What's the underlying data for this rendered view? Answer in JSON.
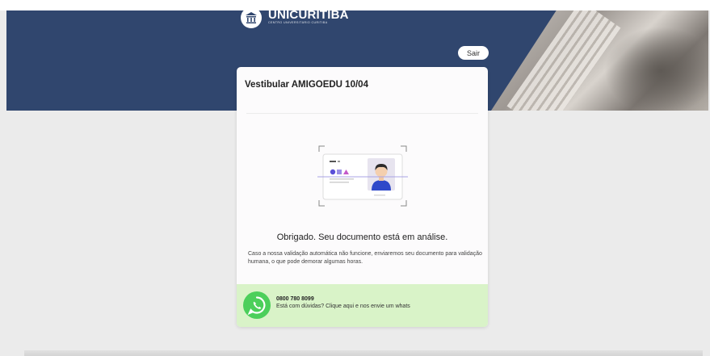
{
  "header": {
    "logo_title": "UNICURITIBA",
    "logo_subtitle": "CENTRO UNIVERSITÁRIO CURITIBA",
    "logout_label": "Sair"
  },
  "card": {
    "title": "Vestibular AMIGOEDU 10/04",
    "success_title": "Obrigado. Seu documento está em análise.",
    "success_description": "Caso a nossa validação automática não funcione, enviaremos seu documento para validação humana, o que pode demorar algumas horas."
  },
  "whatsapp": {
    "phone": "0800 780 8099",
    "help_text": "Está com dúvidas? Clique aqui e nos envie um whats"
  },
  "colors": {
    "hero_blue": "#30466e",
    "whatsapp_green": "#4ccf5b",
    "whatsapp_bar": "#d9f3c8",
    "accent_violet": "#5a4fd8",
    "shirt_blue": "#2f49c9"
  }
}
